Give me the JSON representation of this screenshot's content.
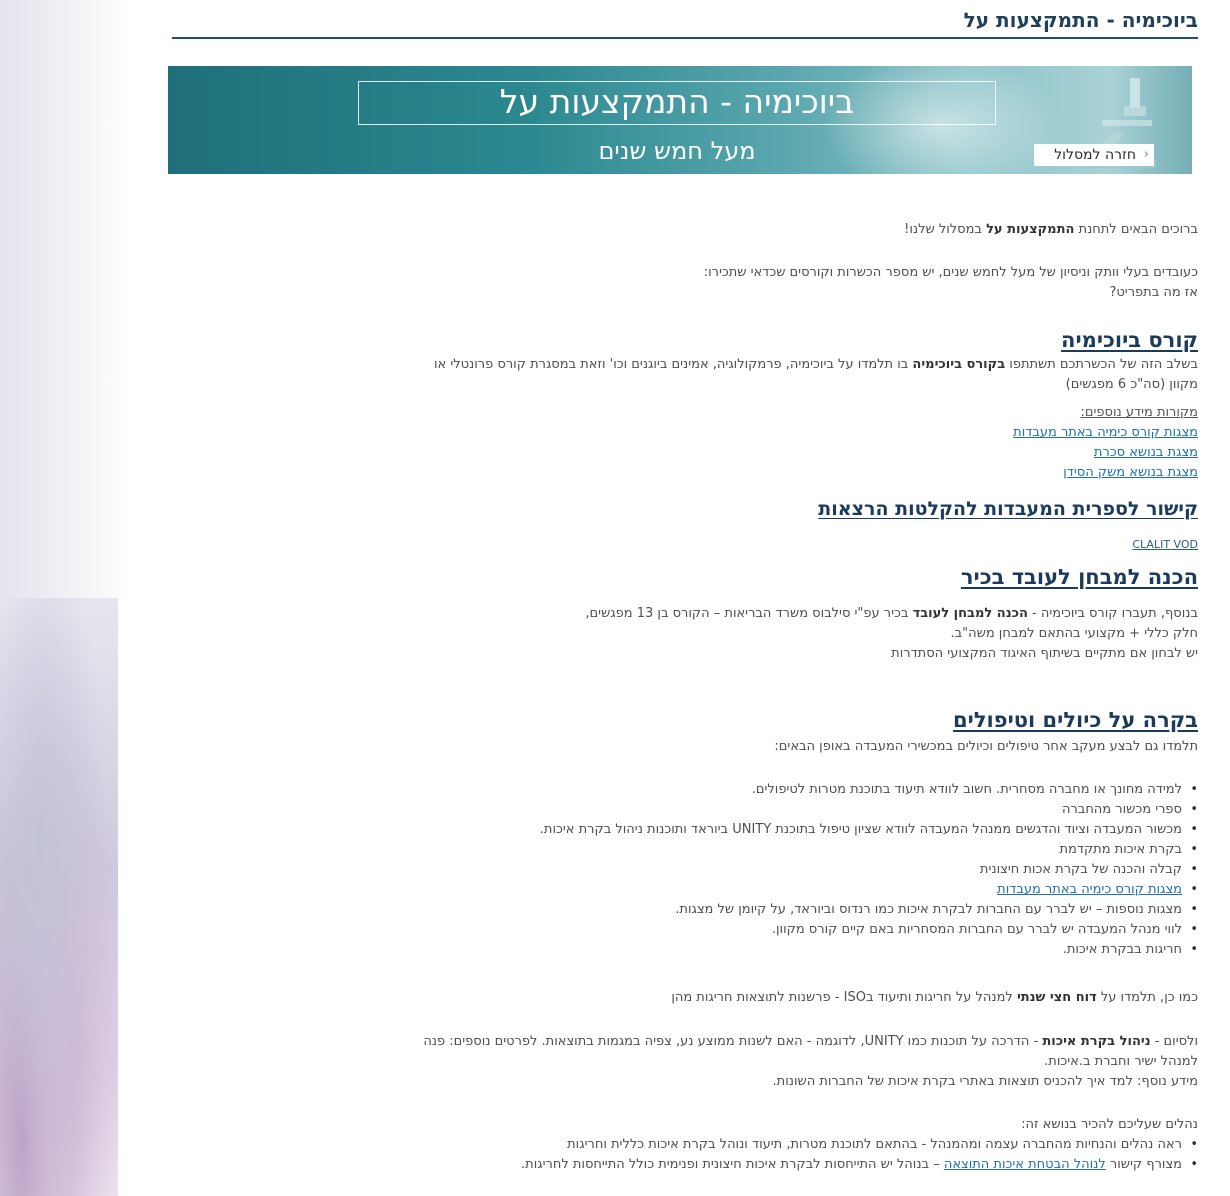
{
  "page": {
    "title": "ביוכימיה - התמקצעות על"
  },
  "banner": {
    "headline": "ביוכימיה - התמקצעות על",
    "subline": "מעל חמש שנים",
    "back_label": "חזרה למסלול",
    "back_chevron": "‹"
  },
  "intro": {
    "welcome_pre": "ברוכים הבאים לתחנת ",
    "welcome_bold": "התמקצעות על",
    "welcome_post": " במסלול שלנו!",
    "line2": "כעובדים בעלי וותק וניסיון של מעל לחמש שנים, יש מספר הכשרות וקורסים שכדאי שתכירו:",
    "line3": "אז מה בתפריט?"
  },
  "course": {
    "heading": "קורס ביוכימיה",
    "text_pre": "בשלב הזה של הכשרתכם תשתתפו ",
    "text_bold": "בקורס ביוכימיה",
    "text_post": " בו תלמדו על ביוכימיה, פרמקולוגיה, אמינים ביוגנים וכו' וזאת במסגרת קורס פרונטלי או",
    "text_line2": "מקוון (סה\"כ 6 מפגשים)",
    "sources_label": "מקורות מידע נוספים:",
    "links": [
      "מצגות קורס כימיה באתר מעבדות",
      "מצגת בנושא סכרת",
      "מצגת בנושא משק הסידן"
    ]
  },
  "library": {
    "heading": "קישור לספרית המעבדות להקלטות הרצאות",
    "link": "CLALIT VOD"
  },
  "exam": {
    "heading": "הכנה למבחן לעובד בכיר",
    "line1_pre": "בנוסף, תעברו קורס ביוכימיה - ",
    "line1_bold": "הכנה למבחן לעובד",
    "line1_post": " בכיר עפ\"י סילבוס משרד הבריאות – הקורס בן 13 מפגשים,",
    "line2": "חלק כללי + מקצועי בהתאם למבחן משה\"ב.",
    "line3": "יש לבחון אם מתקיים בשיתוף האיגוד המקצועי הסתדרות"
  },
  "qc": {
    "heading": "בקרה על כיולים וטיפולים",
    "intro": "תלמדו גם לבצע מעקב אחר טיפולים וכיולים במכשירי המעבדה באופן הבאים:",
    "bullets": [
      "למידה מחונך או מחברה מסחרית. חשוב לוודא תיעוד בתוכנת מטרות לטיפולים.",
      "ספרי מכשור מהחברה",
      "מכשור המעבדה וציוד והדגשים ממנהל המעבדה לוודא שציון טיפול בתוכנת UNITY ביוראד ותוכנות ניהול בקרת איכות.",
      "בקרת איכות מתקדמת",
      "קבלה והכנה של בקרת אכות חיצונית",
      "מצגות קורס כימיה באתר מעבדות",
      "מצגות נוספות – יש לברר עם החברות לבקרת איכות כמו רנדוס וביוראד, על קיומן של מצגות.",
      "לווי מנהל המעבדה יש לברר עם החברות המסחריות באם קיים קורס מקוון.",
      "חריגות בבקרת איכות."
    ],
    "report_pre": "כמו כן, תלמדו על ",
    "report_bold": "דוח חצי שנתי",
    "report_post": " למנהל על חריגות ותיעוד בISO  - פרשנות לתוצאות חריגות מהן",
    "mgmt_pre": "ולסיום - ",
    "mgmt_bold": "ניהול בקרת איכות",
    "mgmt_post": " - הדרכה על תוכנות כמו UNITY, לדוגמה - האם לשנות ממוצע נע, צפיה במגמות בתוצאות. לפרטים נוספים: פנה",
    "mgmt_line2": "למנהל ישיר וחברת ב.איכות.",
    "mgmt_line3": "מידע נוסף: למד איך להכניס תוצאות באתרי בקרת איכות של החברות השונות.",
    "procedures_label": "נהלים שעליכם להכיר בנושא זה:",
    "proc1": "ראה נהלים והנחיות מהחברה עצמה ומהמנהל - בהתאם לתוכנת מטרות, תיעוד ונוהל בקרת איכות כללית וחריגות",
    "proc2_pre": "מצורף קישור ",
    "proc2_link": "לנוהל הבטחת איכות התוצאה",
    "proc2_post": " – בנוהל יש התייחסות לבקרת איכות חיצונית ופנימית כולל התייחסות לחריגות."
  }
}
